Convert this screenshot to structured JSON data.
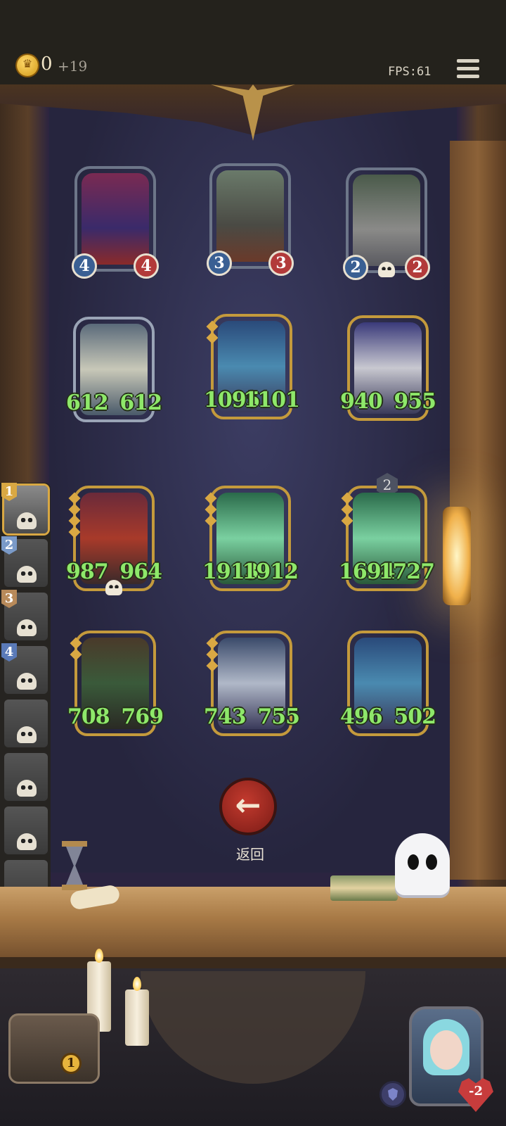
{
  "header": {
    "gold": "0",
    "gold_income": "+19",
    "fps": "FPS:61"
  },
  "shop": {
    "cards": [
      {
        "atk": "4",
        "hp": "4"
      },
      {
        "atk": "3",
        "hp": "3"
      },
      {
        "atk": "2",
        "hp": "2"
      }
    ]
  },
  "board": {
    "cards": [
      {
        "atk": "612",
        "hp": "612"
      },
      {
        "atk": "1095",
        "hp": "1101"
      },
      {
        "atk": "940",
        "hp": "955"
      },
      {
        "atk": "987",
        "hp": "964"
      },
      {
        "atk": "1913",
        "hp": "1912"
      },
      {
        "atk": "1694",
        "hp": "1727",
        "tier": "2"
      },
      {
        "atk": "708",
        "hp": "769"
      },
      {
        "atk": "743",
        "hp": "755"
      },
      {
        "atk": "496",
        "hp": "502"
      }
    ]
  },
  "players": {
    "ranks": [
      "1",
      "2",
      "3",
      "4"
    ]
  },
  "back": {
    "label": "返回"
  },
  "chest": {
    "count": "1"
  },
  "hero": {
    "health": "-2"
  },
  "colors": {
    "stat_green": "#8ee86a",
    "gold_border": "#c49a3c",
    "back_red": "#c33a2e"
  },
  "icons": [
    "gold-coin-icon",
    "menu-icon",
    "skull-icon",
    "back-arrow-icon",
    "armor-icon",
    "heart-icon",
    "treasure-chest-icon"
  ]
}
